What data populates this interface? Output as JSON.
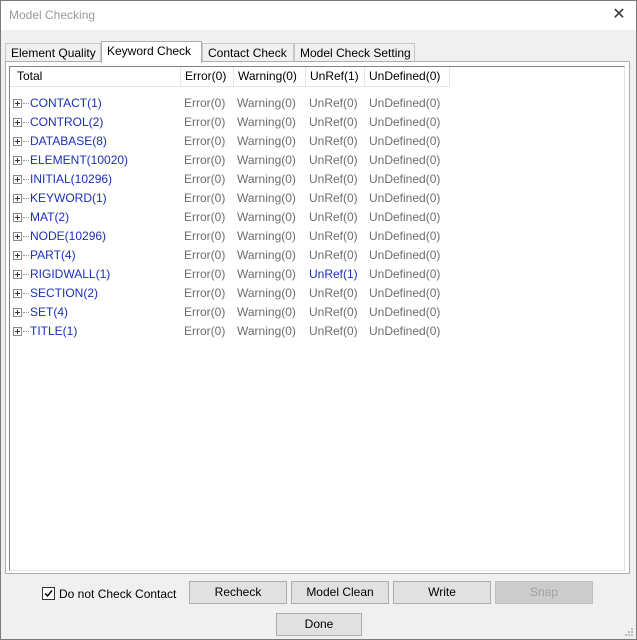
{
  "window": {
    "title": "Model Checking",
    "close_label": "✕"
  },
  "tabs": [
    {
      "label": "Element Quality",
      "active": false
    },
    {
      "label": "Keyword Check",
      "active": true
    },
    {
      "label": "Contact Check",
      "active": false
    },
    {
      "label": "Model Check Setting",
      "active": false
    }
  ],
  "table": {
    "headers": [
      "Total",
      "Error(0)",
      "Warning(0)",
      "UnRef(1)",
      "UnDefined(0)"
    ],
    "rows": [
      {
        "name": "CONTACT(1)",
        "error": "Error(0)",
        "warning": "Warning(0)",
        "unref": "UnRef(0)",
        "undefined": "UnDefined(0)",
        "unref_highlight": false
      },
      {
        "name": "CONTROL(2)",
        "error": "Error(0)",
        "warning": "Warning(0)",
        "unref": "UnRef(0)",
        "undefined": "UnDefined(0)",
        "unref_highlight": false
      },
      {
        "name": "DATABASE(8)",
        "error": "Error(0)",
        "warning": "Warning(0)",
        "unref": "UnRef(0)",
        "undefined": "UnDefined(0)",
        "unref_highlight": false
      },
      {
        "name": "ELEMENT(10020)",
        "error": "Error(0)",
        "warning": "Warning(0)",
        "unref": "UnRef(0)",
        "undefined": "UnDefined(0)",
        "unref_highlight": false
      },
      {
        "name": "INITIAL(10296)",
        "error": "Error(0)",
        "warning": "Warning(0)",
        "unref": "UnRef(0)",
        "undefined": "UnDefined(0)",
        "unref_highlight": false
      },
      {
        "name": "KEYWORD(1)",
        "error": "Error(0)",
        "warning": "Warning(0)",
        "unref": "UnRef(0)",
        "undefined": "UnDefined(0)",
        "unref_highlight": false
      },
      {
        "name": "MAT(2)",
        "error": "Error(0)",
        "warning": "Warning(0)",
        "unref": "UnRef(0)",
        "undefined": "UnDefined(0)",
        "unref_highlight": false
      },
      {
        "name": "NODE(10296)",
        "error": "Error(0)",
        "warning": "Warning(0)",
        "unref": "UnRef(0)",
        "undefined": "UnDefined(0)",
        "unref_highlight": false
      },
      {
        "name": "PART(4)",
        "error": "Error(0)",
        "warning": "Warning(0)",
        "unref": "UnRef(0)",
        "undefined": "UnDefined(0)",
        "unref_highlight": false
      },
      {
        "name": "RIGIDWALL(1)",
        "error": "Error(0)",
        "warning": "Warning(0)",
        "unref": "UnRef(1)",
        "undefined": "UnDefined(0)",
        "unref_highlight": true
      },
      {
        "name": "SECTION(2)",
        "error": "Error(0)",
        "warning": "Warning(0)",
        "unref": "UnRef(0)",
        "undefined": "UnDefined(0)",
        "unref_highlight": false
      },
      {
        "name": "SET(4)",
        "error": "Error(0)",
        "warning": "Warning(0)",
        "unref": "UnRef(0)",
        "undefined": "UnDefined(0)",
        "unref_highlight": false
      },
      {
        "name": "TITLE(1)",
        "error": "Error(0)",
        "warning": "Warning(0)",
        "unref": "UnRef(0)",
        "undefined": "UnDefined(0)",
        "unref_highlight": false
      }
    ]
  },
  "bottom": {
    "checkbox_label": "Do not Check Contact",
    "checkbox_checked": true,
    "buttons": [
      {
        "label": "Recheck",
        "enabled": true
      },
      {
        "label": "Model Clean",
        "enabled": true
      },
      {
        "label": "Write",
        "enabled": true
      },
      {
        "label": "Snap",
        "enabled": false
      }
    ],
    "done_label": "Done"
  },
  "colors": {
    "link": "#1a2fb8",
    "muted": "#6d6d6d"
  }
}
